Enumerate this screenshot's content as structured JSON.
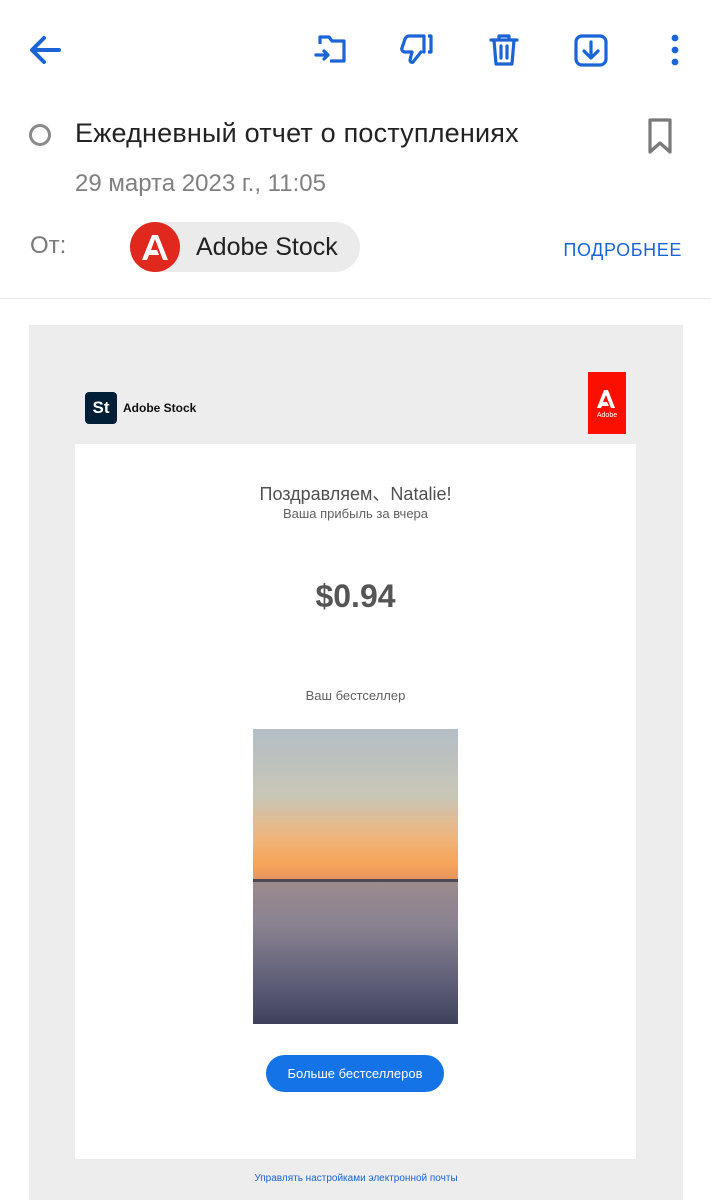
{
  "toolbar": {
    "icons": [
      "back-arrow-icon",
      "move-to-folder-icon",
      "dislike-icon",
      "trash-icon",
      "download-icon",
      "more-vert-icon"
    ]
  },
  "colors": {
    "accent": "#1a64d6",
    "adobe_red": "#fa0f00",
    "stock_navy": "#001e36",
    "button_blue": "#1473e6"
  },
  "message": {
    "subject": "Ежедневный отчет о поступлениях",
    "date": "29 марта 2023 г., 11:05",
    "from_label": "От:",
    "sender_name": "Adobe Stock",
    "details_link": "ПОДРОБНЕЕ"
  },
  "email": {
    "brand_name": "Adobe Stock",
    "brand_badge": "St",
    "adobe_tag": "Adobe",
    "greeting": "Поздравляем、Natalie!",
    "sub_greeting": "Ваша прибыль за вчера",
    "amount": "$0.94",
    "bestseller_label": "Ваш бестселлер",
    "more_button": "Больше бестселлеров",
    "footer_link": "Управлять настройками электронной почты"
  }
}
